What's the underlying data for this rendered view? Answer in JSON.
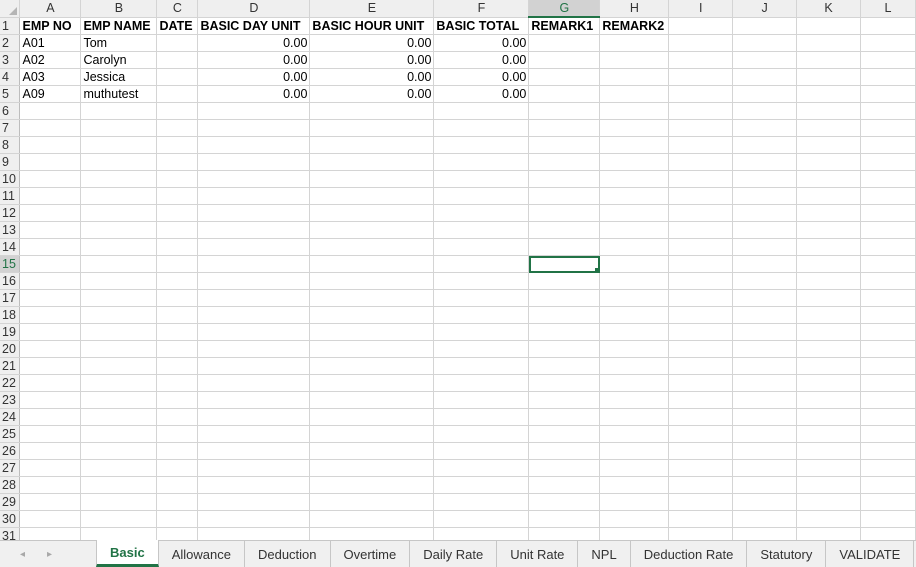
{
  "columns": [
    "A",
    "B",
    "C",
    "D",
    "E",
    "F",
    "G",
    "H",
    "I",
    "J",
    "K",
    "L"
  ],
  "selected_column": "G",
  "selected_row": "15",
  "rows": [
    {
      "num": "1",
      "cells": [
        "EMP NO",
        "EMP NAME",
        "DATE",
        "BASIC DAY UNIT",
        "BASIC HOUR UNIT",
        "BASIC TOTAL",
        "REMARK1",
        "REMARK2",
        "",
        "",
        "",
        ""
      ]
    },
    {
      "num": "2",
      "cells": [
        "A01",
        "Tom",
        "",
        "0.00",
        "0.00",
        "0.00",
        "",
        "",
        "",
        "",
        "",
        ""
      ]
    },
    {
      "num": "3",
      "cells": [
        "A02",
        "Carolyn",
        "",
        "0.00",
        "0.00",
        "0.00",
        "",
        "",
        "",
        "",
        "",
        ""
      ]
    },
    {
      "num": "4",
      "cells": [
        "A03",
        "Jessica",
        "",
        "0.00",
        "0.00",
        "0.00",
        "",
        "",
        "",
        "",
        "",
        ""
      ]
    },
    {
      "num": "5",
      "cells": [
        "A09",
        "muthutest",
        "",
        "0.00",
        "0.00",
        "0.00",
        "",
        "",
        "",
        "",
        "",
        ""
      ]
    },
    {
      "num": "6",
      "cells": [
        "",
        "",
        "",
        "",
        "",
        "",
        "",
        "",
        "",
        "",
        "",
        ""
      ]
    },
    {
      "num": "7",
      "cells": [
        "",
        "",
        "",
        "",
        "",
        "",
        "",
        "",
        "",
        "",
        "",
        ""
      ]
    },
    {
      "num": "8",
      "cells": [
        "",
        "",
        "",
        "",
        "",
        "",
        "",
        "",
        "",
        "",
        "",
        ""
      ]
    },
    {
      "num": "9",
      "cells": [
        "",
        "",
        "",
        "",
        "",
        "",
        "",
        "",
        "",
        "",
        "",
        ""
      ]
    },
    {
      "num": "10",
      "cells": [
        "",
        "",
        "",
        "",
        "",
        "",
        "",
        "",
        "",
        "",
        "",
        ""
      ]
    },
    {
      "num": "11",
      "cells": [
        "",
        "",
        "",
        "",
        "",
        "",
        "",
        "",
        "",
        "",
        "",
        ""
      ]
    },
    {
      "num": "12",
      "cells": [
        "",
        "",
        "",
        "",
        "",
        "",
        "",
        "",
        "",
        "",
        "",
        ""
      ]
    },
    {
      "num": "13",
      "cells": [
        "",
        "",
        "",
        "",
        "",
        "",
        "",
        "",
        "",
        "",
        "",
        ""
      ]
    },
    {
      "num": "14",
      "cells": [
        "",
        "",
        "",
        "",
        "",
        "",
        "",
        "",
        "",
        "",
        "",
        ""
      ]
    },
    {
      "num": "15",
      "cells": [
        "",
        "",
        "",
        "",
        "",
        "",
        "",
        "",
        "",
        "",
        "",
        ""
      ]
    },
    {
      "num": "16",
      "cells": [
        "",
        "",
        "",
        "",
        "",
        "",
        "",
        "",
        "",
        "",
        "",
        ""
      ]
    },
    {
      "num": "17",
      "cells": [
        "",
        "",
        "",
        "",
        "",
        "",
        "",
        "",
        "",
        "",
        "",
        ""
      ]
    },
    {
      "num": "18",
      "cells": [
        "",
        "",
        "",
        "",
        "",
        "",
        "",
        "",
        "",
        "",
        "",
        ""
      ]
    },
    {
      "num": "19",
      "cells": [
        "",
        "",
        "",
        "",
        "",
        "",
        "",
        "",
        "",
        "",
        "",
        ""
      ]
    },
    {
      "num": "20",
      "cells": [
        "",
        "",
        "",
        "",
        "",
        "",
        "",
        "",
        "",
        "",
        "",
        ""
      ]
    },
    {
      "num": "21",
      "cells": [
        "",
        "",
        "",
        "",
        "",
        "",
        "",
        "",
        "",
        "",
        "",
        ""
      ]
    },
    {
      "num": "22",
      "cells": [
        "",
        "",
        "",
        "",
        "",
        "",
        "",
        "",
        "",
        "",
        "",
        ""
      ]
    },
    {
      "num": "23",
      "cells": [
        "",
        "",
        "",
        "",
        "",
        "",
        "",
        "",
        "",
        "",
        "",
        ""
      ]
    },
    {
      "num": "24",
      "cells": [
        "",
        "",
        "",
        "",
        "",
        "",
        "",
        "",
        "",
        "",
        "",
        ""
      ]
    },
    {
      "num": "25",
      "cells": [
        "",
        "",
        "",
        "",
        "",
        "",
        "",
        "",
        "",
        "",
        "",
        ""
      ]
    },
    {
      "num": "26",
      "cells": [
        "",
        "",
        "",
        "",
        "",
        "",
        "",
        "",
        "",
        "",
        "",
        ""
      ]
    },
    {
      "num": "27",
      "cells": [
        "",
        "",
        "",
        "",
        "",
        "",
        "",
        "",
        "",
        "",
        "",
        ""
      ]
    },
    {
      "num": "28",
      "cells": [
        "",
        "",
        "",
        "",
        "",
        "",
        "",
        "",
        "",
        "",
        "",
        ""
      ]
    },
    {
      "num": "29",
      "cells": [
        "",
        "",
        "",
        "",
        "",
        "",
        "",
        "",
        "",
        "",
        "",
        ""
      ]
    },
    {
      "num": "30",
      "cells": [
        "",
        "",
        "",
        "",
        "",
        "",
        "",
        "",
        "",
        "",
        "",
        ""
      ]
    },
    {
      "num": "31",
      "cells": [
        "",
        "",
        "",
        "",
        "",
        "",
        "",
        "",
        "",
        "",
        "",
        ""
      ]
    }
  ],
  "tabs": [
    {
      "label": "Basic",
      "active": true
    },
    {
      "label": "Allowance",
      "active": false
    },
    {
      "label": "Deduction",
      "active": false
    },
    {
      "label": "Overtime",
      "active": false
    },
    {
      "label": "Daily Rate",
      "active": false
    },
    {
      "label": "Unit Rate",
      "active": false
    },
    {
      "label": "NPL",
      "active": false
    },
    {
      "label": "Deduction Rate",
      "active": false
    },
    {
      "label": "Statutory",
      "active": false
    },
    {
      "label": "VALIDATE",
      "active": false
    }
  ],
  "nav": {
    "prev_icon": "◂",
    "next_icon": "▸"
  },
  "colors": {
    "accent": "#217346"
  }
}
